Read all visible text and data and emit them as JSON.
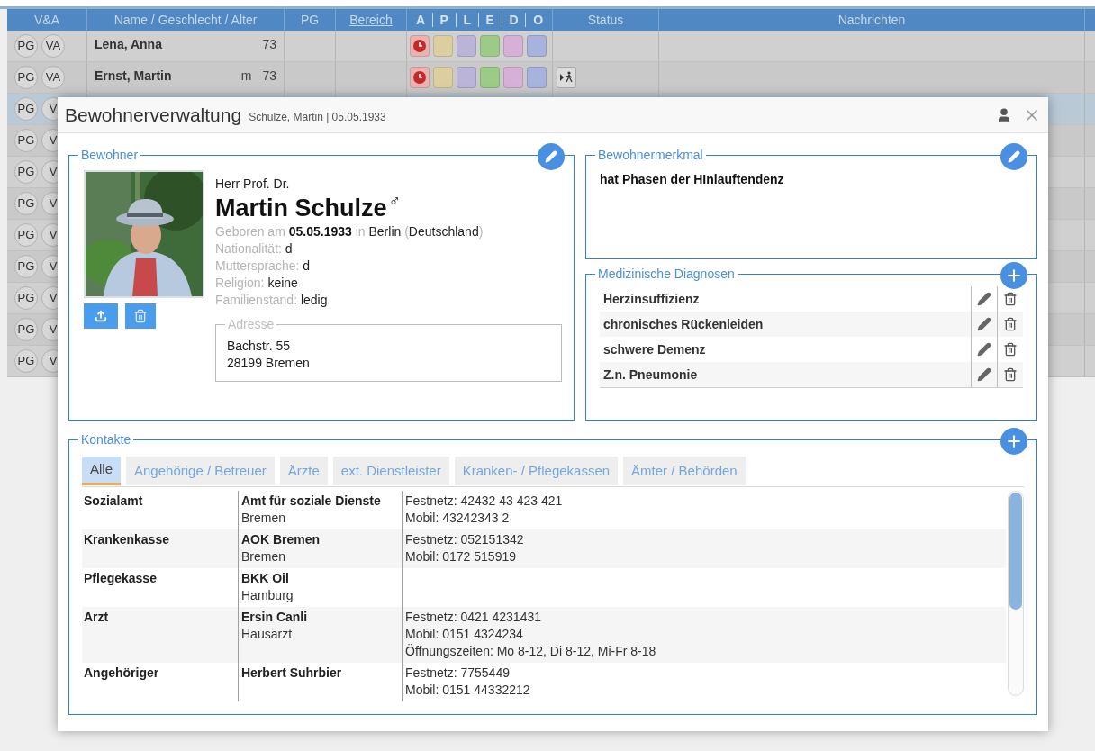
{
  "table": {
    "columns": [
      {
        "label": "V&A",
        "kind": "plain"
      },
      {
        "label": "Name / Geschlecht / Alter",
        "kind": "plain"
      },
      {
        "label": "PG",
        "kind": "plain"
      },
      {
        "label": "Bereich",
        "kind": "link"
      },
      {
        "label": "Status",
        "kind": "plain"
      },
      {
        "label": "Nachrichten",
        "kind": "plain"
      }
    ],
    "category_columns": [
      "A",
      "P",
      "L",
      "E",
      "D",
      "O"
    ],
    "rows": [
      {
        "badges": [
          "PG",
          "VA"
        ],
        "name": "Lena, Anna",
        "gender": "",
        "age": "73",
        "selected": false,
        "status_flag": false,
        "flags": [
          {
            "kind": "clock",
            "color": "#e9b3b3"
          },
          {
            "kind": "plain",
            "color": "#dccf9f"
          },
          {
            "kind": "plain",
            "color": "#bab4d9"
          },
          {
            "kind": "plain",
            "color": "#9ccb88"
          },
          {
            "kind": "plain",
            "color": "#d7b0d8"
          },
          {
            "kind": "plain",
            "color": "#a7b3dc"
          }
        ]
      },
      {
        "badges": [
          "PG",
          "VA"
        ],
        "name": "Ernst, Martin",
        "gender": "m",
        "age": "73",
        "selected": false,
        "status_flag": true,
        "flags": [
          {
            "kind": "clock",
            "color": "#e9b3b3"
          },
          {
            "kind": "plain",
            "color": "#dccf9f"
          },
          {
            "kind": "plain",
            "color": "#bab4d9"
          },
          {
            "kind": "plain",
            "color": "#9ccb88"
          },
          {
            "kind": "plain",
            "color": "#d7b0d8"
          },
          {
            "kind": "plain",
            "color": "#a7b3dc"
          }
        ]
      },
      {
        "badges": [
          "PG",
          "V"
        ],
        "selected": true,
        "status_flag": false
      },
      {
        "badges": [
          "PG",
          "V"
        ],
        "selected": false,
        "status_flag": false
      },
      {
        "badges": [
          "PG",
          "V"
        ],
        "selected": false,
        "status_flag": false
      },
      {
        "badges": [
          "PG",
          "V"
        ],
        "selected": false,
        "status_flag": false
      },
      {
        "badges": [
          "PG",
          "V"
        ],
        "selected": false,
        "status_flag": false
      },
      {
        "badges": [
          "PG",
          "V"
        ],
        "selected": false,
        "status_flag": false
      },
      {
        "badges": [
          "PG",
          "V"
        ],
        "selected": false,
        "status_flag": false
      },
      {
        "badges": [
          "PG",
          "V"
        ],
        "selected": false,
        "status_flag": false
      },
      {
        "badges": [
          "PG",
          "V"
        ],
        "selected": false,
        "status_flag": false
      }
    ]
  },
  "dialog": {
    "title": "Bewohnerverwaltung",
    "subtitle": "Schulze, Martin | 05.05.1933",
    "resident": {
      "legend": "Bewohner",
      "salutation": "Herr Prof. Dr.",
      "name": "Martin Schulze",
      "gender_symbol": "♂",
      "birth": [
        {
          "kind": "label",
          "text": "Geboren am "
        },
        {
          "kind": "bold",
          "text": "05.05.1933"
        },
        {
          "kind": "label",
          "text": " in "
        },
        {
          "kind": "value",
          "text": "Berlin "
        },
        {
          "kind": "label",
          "text": "("
        },
        {
          "kind": "value",
          "text": "Deutschland"
        },
        {
          "kind": "label",
          "text": ")"
        }
      ],
      "details": [
        {
          "label": "Nationalität:",
          "value": "d"
        },
        {
          "label": "Muttersprache:",
          "value": "d"
        },
        {
          "label": "Religion:",
          "value": "keine"
        },
        {
          "label": "Familienstand:",
          "value": "ledig"
        }
      ],
      "address": {
        "legend": "Adresse",
        "lines": [
          "Bachstr. 55",
          "28199 Bremen"
        ]
      }
    },
    "feature": {
      "legend": "Bewohnermerkmal",
      "text": "hat Phasen der HInlauftendenz"
    },
    "diagnoses": {
      "legend": "Medizinische Diagnosen",
      "items": [
        "Herzinsuffizienz",
        "chronisches Rückenleiden",
        "schwere Demenz",
        "Z.n. Pneumonie"
      ]
    },
    "contacts": {
      "legend": "Kontakte",
      "tabs": [
        {
          "label": "Alle",
          "selected": true
        },
        {
          "label": "Angehörige / Betreuer",
          "selected": false
        },
        {
          "label": "Ärzte",
          "selected": false
        },
        {
          "label": "ext. Dienstleister",
          "selected": false
        },
        {
          "label": "Kranken- / Pflegekassen",
          "selected": false
        },
        {
          "label": "Ämter / Behörden",
          "selected": false
        }
      ],
      "rows": [
        {
          "type": "Sozialamt",
          "name": "Amt für soziale Dienste",
          "place": "Bremen",
          "details": [
            "Festnetz: 42432 43 423 421",
            "Mobil: 43242343 2"
          ]
        },
        {
          "type": "Krankenkasse",
          "name": "AOK Bremen",
          "place": "Bremen",
          "details": [
            "Festnetz: 052151342",
            "Mobil: 0172 515919"
          ]
        },
        {
          "type": "Pflegekasse",
          "name": "BKK Oil",
          "place": "Hamburg",
          "details": []
        },
        {
          "type": "Arzt",
          "name": "Ersin Canli",
          "place": "Hausarzt",
          "details": [
            "Festnetz: 0421 4231431",
            "Mobil: 0151 4324234",
            "Öffnungszeiten: Mo 8-12, Di 8-12, Mi-Fr 8-18"
          ]
        },
        {
          "type": "Angehöriger",
          "name": "Herbert Suhrbier",
          "place": "",
          "details": [
            "Festnetz: 7755449",
            "Mobil: 0151 44332212"
          ]
        }
      ]
    }
  }
}
